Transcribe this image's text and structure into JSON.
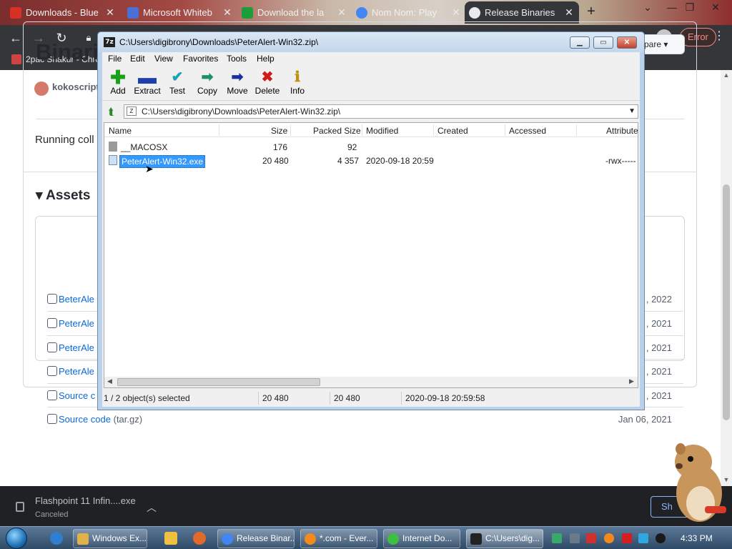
{
  "browser": {
    "tabs": [
      {
        "label": "Downloads - Blue",
        "favicon_color": "#d93025",
        "active": false
      },
      {
        "label": "Microsoft Whiteb",
        "favicon_color": "#4a6fd6",
        "active": false
      },
      {
        "label": "Download the la",
        "favicon_color": "#1b9e3a",
        "active": false
      },
      {
        "label": "Nom Nom: Play",
        "favicon_color": "#4285f4",
        "active": false
      },
      {
        "label": "Release Binaries",
        "favicon_color": "#e8eaed",
        "active": true
      }
    ],
    "new_tab_label": "+",
    "profile_error_label": "Error",
    "bookmark_label": "2pac Shakur - Chro"
  },
  "github": {
    "release_title": "Binarie",
    "compare_label": "pare",
    "author": "kokoscript",
    "body_text": "Running coll",
    "assets_heading": "Assets",
    "assets": [
      {
        "name": "BeterAle",
        "suffix": "",
        "date": ", 2022"
      },
      {
        "name": "PeterAle",
        "suffix": "",
        "date": ", 2021"
      },
      {
        "name": "PeterAle",
        "suffix": "",
        "date": ", 2021"
      },
      {
        "name": "PeterAle",
        "suffix": "",
        "date": ", 2021"
      },
      {
        "name": "Source c",
        "suffix": "",
        "date": ", 2021"
      },
      {
        "name": "Source code ",
        "suffix": "(tar.gz)",
        "date": "Jan 06, 2021"
      }
    ]
  },
  "zip": {
    "window_title": "C:\\Users\\digibrony\\Downloads\\PeterAlert-Win32.zip\\",
    "app_icon_text": "7z",
    "menu": [
      "File",
      "Edit",
      "View",
      "Favorites",
      "Tools",
      "Help"
    ],
    "tools": [
      {
        "label": "Add",
        "icon": "+",
        "color": "#1aa01a"
      },
      {
        "label": "Extract",
        "icon": "−",
        "color": "#1f3fb0"
      },
      {
        "label": "Test",
        "icon": "✔",
        "color": "#19a3b8"
      },
      {
        "label": "Copy",
        "icon": "➡",
        "color": "#1f8f6a"
      },
      {
        "label": "Move",
        "icon": "➡",
        "color": "#1a2fa0"
      },
      {
        "label": "Delete",
        "icon": "✖",
        "color": "#d01a1a"
      },
      {
        "label": "Info",
        "icon": "ℹ",
        "color": "#b89410"
      }
    ],
    "path": "C:\\Users\\digibrony\\Downloads\\PeterAlert-Win32.zip\\",
    "columns": [
      "Name",
      "Size",
      "Packed Size",
      "Modified",
      "Created",
      "Accessed",
      "Attribute"
    ],
    "rows": [
      {
        "name": "__MACOSX",
        "size": "176",
        "packed": "92",
        "modified": "",
        "created": "",
        "accessed": "",
        "attr": "",
        "selected": false,
        "folder": true
      },
      {
        "name": "PeterAlert-Win32.exe",
        "size": "20 480",
        "packed": "4 357",
        "modified": "2020-09-18 20:59",
        "created": "",
        "accessed": "",
        "attr": "-rwx-----",
        "selected": true,
        "folder": false
      }
    ],
    "status": {
      "selection": "1 / 2 object(s) selected",
      "size": "20 480",
      "packed": "20 480",
      "modified": "2020-09-18 20:59:58"
    }
  },
  "download_bar": {
    "file_name": "Flashpoint 11 Infin....exe",
    "file_status": "Canceled",
    "show_all_label": "Sh"
  },
  "taskbar": {
    "items": [
      {
        "label": "Windows Ex...",
        "icon_color": "#e0b24a"
      },
      {
        "label": "Release Binar...",
        "icon_color": "#4285f4"
      },
      {
        "label": "*.com - Ever...",
        "icon_color": "#f28b1b"
      },
      {
        "label": "Internet Do...",
        "icon_color": "#3fbf3f"
      },
      {
        "label": "C:\\Users\\dig...",
        "icon_color": "#222222"
      }
    ],
    "clock": "4:33 PM"
  }
}
